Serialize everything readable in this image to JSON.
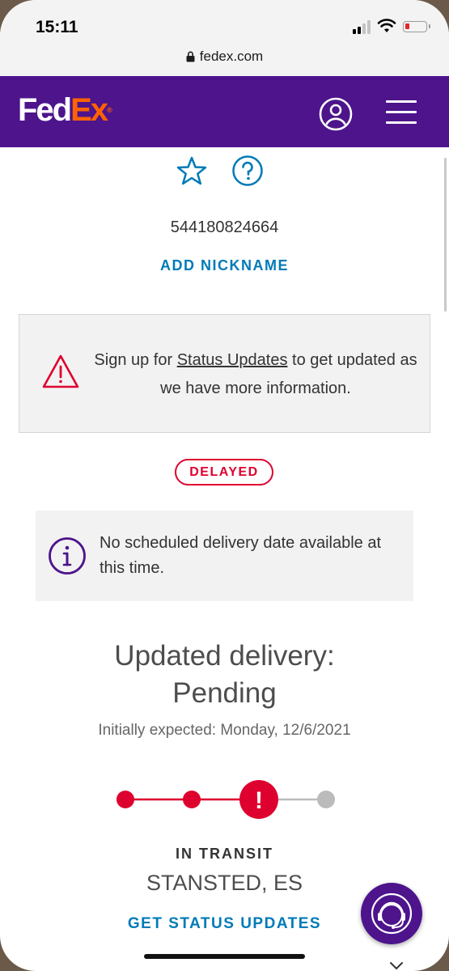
{
  "status_bar": {
    "time": "15:11",
    "icons": [
      "signal-icon",
      "wifi-icon",
      "battery-low-icon"
    ]
  },
  "browser": {
    "url": "fedex.com",
    "lock_icon": "lock-icon"
  },
  "header": {
    "logo_fed": "Fed",
    "logo_ex": "Ex",
    "logo_reg": "®",
    "brand_purple": "#4d148c",
    "brand_orange": "#ff6200",
    "user_icon": "user-account-icon",
    "menu_icon": "hamburger-menu-icon"
  },
  "shipment": {
    "star_icon": "star-icon",
    "help_icon": "help-question-icon",
    "tracking_number": "544180824664",
    "add_nickname": "ADD NICKNAME"
  },
  "alert": {
    "icon": "warning-triangle-icon",
    "text_before": "Sign up for ",
    "link": "Status Updates",
    "text_after": " to get updated as we have more information."
  },
  "status_badge": {
    "label": "DELAYED",
    "color": "#de002e"
  },
  "info": {
    "icon": "info-icon",
    "text": "No scheduled delivery date available at this time."
  },
  "delivery": {
    "title": "Updated delivery:",
    "status": "Pending",
    "initially_expected": "Initially expected: Monday, 12/6/2021"
  },
  "progress": {
    "steps_total": 4,
    "steps_completed": 2,
    "current_step_state": "exception",
    "current_step_symbol": "!",
    "active_color": "#de002e",
    "inactive_color": "#bbbbbb"
  },
  "transit": {
    "label": "IN TRANSIT",
    "location": "STANSTED, ES",
    "get_updates": "GET STATUS UPDATES"
  },
  "chat": {
    "icon": "customer-support-headset-icon"
  }
}
